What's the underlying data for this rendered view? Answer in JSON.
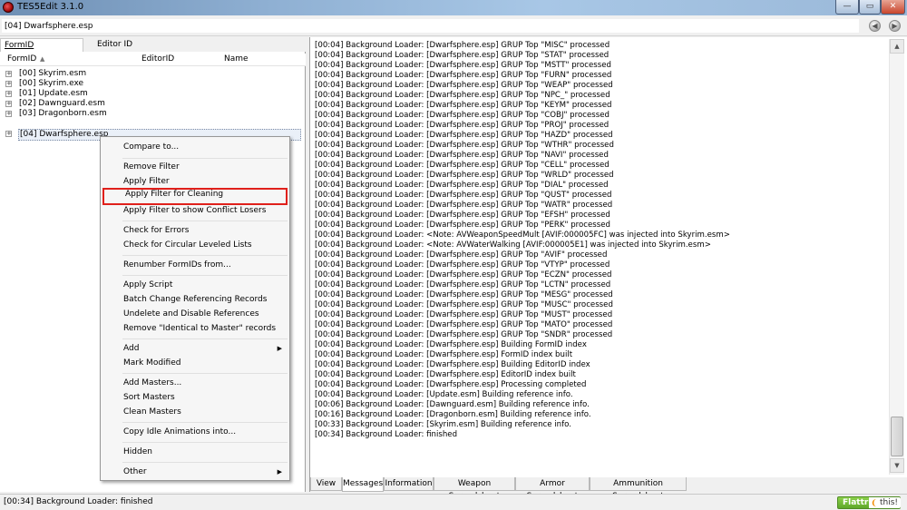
{
  "window": {
    "title": "TES5Edit 3.1.0",
    "min_glyph": "—",
    "max_glyph": "▭",
    "close_glyph": "✕"
  },
  "pathbar": {
    "value": "[04] Dwarfsphere.esp",
    "back_icon": "back-arrow-icon",
    "forward_icon": "forward-arrow-icon"
  },
  "left": {
    "tabs": [
      "FormID",
      "Editor ID"
    ],
    "columns": {
      "formid": "FormID",
      "sort": "▲",
      "editorid": "EditorID",
      "name": "Name"
    },
    "expand_glyph": "+",
    "rows": [
      "[00] Skyrim.esm",
      "[00] Skyrim.exe",
      "[01] Update.esm",
      "[02] Dawnguard.esm",
      "[03] Dragonborn.esm",
      "[04] Dwarfsphere.esp"
    ],
    "selected_index": 5
  },
  "context_menu": {
    "submenu_arrow": "▶",
    "items": [
      "Compare to...",
      "Remove Filter",
      "Apply Filter",
      "Apply Filter for Cleaning",
      "Apply Filter to show Conflict Losers",
      "Check for Errors",
      "Check for Circular Leveled Lists",
      "Renumber FormIDs from...",
      "Apply Script",
      "Batch Change Referencing Records",
      "Undelete and Disable References",
      "Remove \"Identical to Master\" records",
      "Add",
      "Mark Modified",
      "Add Masters...",
      "Sort Masters",
      "Clean Masters",
      "Copy Idle Animations into...",
      "Hidden",
      "Other"
    ],
    "highlighted_item": "Apply Filter for Cleaning",
    "highlight_color": "#e0201b"
  },
  "log": {
    "lines": [
      "[00:04] Background Loader: [Dwarfsphere.esp] GRUP Top \"MISC\" processed",
      "[00:04] Background Loader: [Dwarfsphere.esp] GRUP Top \"STAT\" processed",
      "[00:04] Background Loader: [Dwarfsphere.esp] GRUP Top \"MSTT\" processed",
      "[00:04] Background Loader: [Dwarfsphere.esp] GRUP Top \"FURN\" processed",
      "[00:04] Background Loader: [Dwarfsphere.esp] GRUP Top \"WEAP\" processed",
      "[00:04] Background Loader: [Dwarfsphere.esp] GRUP Top \"NPC_\" processed",
      "[00:04] Background Loader: [Dwarfsphere.esp] GRUP Top \"KEYM\" processed",
      "[00:04] Background Loader: [Dwarfsphere.esp] GRUP Top \"COBJ\" processed",
      "[00:04] Background Loader: [Dwarfsphere.esp] GRUP Top \"PROJ\" processed",
      "[00:04] Background Loader: [Dwarfsphere.esp] GRUP Top \"HAZD\" processed",
      "[00:04] Background Loader: [Dwarfsphere.esp] GRUP Top \"WTHR\" processed",
      "[00:04] Background Loader: [Dwarfsphere.esp] GRUP Top \"NAVI\" processed",
      "[00:04] Background Loader: [Dwarfsphere.esp] GRUP Top \"CELL\" processed",
      "[00:04] Background Loader: [Dwarfsphere.esp] GRUP Top \"WRLD\" processed",
      "[00:04] Background Loader: [Dwarfsphere.esp] GRUP Top \"DIAL\" processed",
      "[00:04] Background Loader: [Dwarfsphere.esp] GRUP Top \"QUST\" processed",
      "[00:04] Background Loader: [Dwarfsphere.esp] GRUP Top \"WATR\" processed",
      "[00:04] Background Loader: [Dwarfsphere.esp] GRUP Top \"EFSH\" processed",
      "[00:04] Background Loader: [Dwarfsphere.esp] GRUP Top \"PERK\" processed",
      "[00:04] Background Loader: <Note: AVWeaponSpeedMult [AVIF:000005FC] was injected into Skyrim.esm>",
      "[00:04] Background Loader: <Note: AVWaterWalking [AVIF:000005E1] was injected into Skyrim.esm>",
      "[00:04] Background Loader: [Dwarfsphere.esp] GRUP Top \"AVIF\" processed",
      "[00:04] Background Loader: [Dwarfsphere.esp] GRUP Top \"VTYP\" processed",
      "[00:04] Background Loader: [Dwarfsphere.esp] GRUP Top \"ECZN\" processed",
      "[00:04] Background Loader: [Dwarfsphere.esp] GRUP Top \"LCTN\" processed",
      "[00:04] Background Loader: [Dwarfsphere.esp] GRUP Top \"MESG\" processed",
      "[00:04] Background Loader: [Dwarfsphere.esp] GRUP Top \"MUSC\" processed",
      "[00:04] Background Loader: [Dwarfsphere.esp] GRUP Top \"MUST\" processed",
      "[00:04] Background Loader: [Dwarfsphere.esp] GRUP Top \"MATO\" processed",
      "[00:04] Background Loader: [Dwarfsphere.esp] GRUP Top \"SNDR\" processed",
      "[00:04] Background Loader: [Dwarfsphere.esp] Building FormID index",
      "[00:04] Background Loader: [Dwarfsphere.esp] FormID index built",
      "[00:04] Background Loader: [Dwarfsphere.esp] Building EditorID index",
      "[00:04] Background Loader: [Dwarfsphere.esp] EditorID index built",
      "[00:04] Background Loader: [Dwarfsphere.esp] Processing completed",
      "[00:04] Background Loader: [Update.esm] Building reference info.",
      "[00:06] Background Loader: [Dawnguard.esm] Building reference info.",
      "[00:16] Background Loader: [Dragonborn.esm] Building reference info.",
      "[00:33] Background Loader: [Skyrim.esm] Building reference info.",
      "[00:34] Background Loader: finished"
    ],
    "scroll_up": "▲",
    "scroll_down": "▼"
  },
  "bottom_tabs": [
    "View",
    "Messages",
    "Information",
    "Weapon Spreadsheet",
    "Armor Spreadsheet",
    "Ammunition Spreadsheet"
  ],
  "active_bottom_tab": "Messages",
  "status": {
    "text": "[00:34] Background Loader: finished",
    "flattr_label": "Flattr",
    "flattr_this": "this!",
    "flattr_icon": "flattr-logo-icon",
    "flattr_glyph": "❨"
  },
  "colors": {
    "accent_highlight": "#e0201b",
    "flattr_green": "#6fb534"
  }
}
